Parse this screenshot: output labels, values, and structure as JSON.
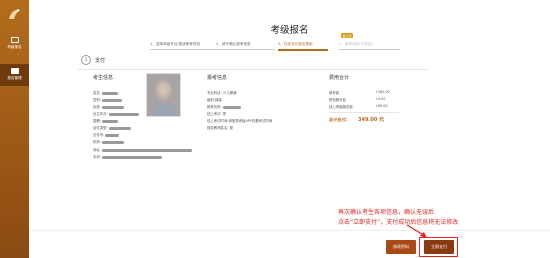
{
  "sidebar": {
    "items": [
      {
        "label": "考级报名",
        "icon": "id-card-icon"
      },
      {
        "label": "报名管理",
        "icon": "list-icon"
      }
    ]
  },
  "page": {
    "title": "考级报名"
  },
  "steps": [
    {
      "label": "1、选择考级专业/报读职考项目"
    },
    {
      "label": "2、填写确认报考信息"
    },
    {
      "label": "3、在线支付报名费用"
    },
    {
      "label": "4、报考成功(已报名)"
    }
  ],
  "step_badge": "第三步",
  "pay_section": {
    "number": "1",
    "label": "支付"
  },
  "personal": {
    "heading": "考生信息",
    "fields": [
      {
        "label": "姓名:"
      },
      {
        "label": "性别:"
      },
      {
        "label": "民族:"
      },
      {
        "label": "出生年月:"
      },
      {
        "label": "国籍:"
      },
      {
        "label": "证件类型:"
      },
      {
        "label": "证件号:"
      },
      {
        "label": "机构:"
      },
      {
        "label": "地址:"
      },
      {
        "label": "手机:"
      }
    ]
  },
  "exam": {
    "heading": "报考信息",
    "fields": [
      {
        "label": "专业科目:",
        "value": "少儿朗诵"
      },
      {
        "label": "级别:",
        "value": "肆级"
      },
      {
        "label": "报考名称:",
        "value": ""
      },
      {
        "label": "线上考试:",
        "value": "是"
      },
      {
        "label": "线上考试时间:",
        "value": "请登录考级APP查看考试时间"
      },
      {
        "label": "指导教师姓名:",
        "value": "是"
      }
    ]
  },
  "fees": {
    "heading": "费用合计",
    "items": [
      {
        "label": "报考费",
        "value": "+260.00"
      },
      {
        "label": "短信服务费",
        "value": "+4.00"
      },
      {
        "label": "线上考级服务费",
        "value": "+85.00"
      }
    ],
    "total_label": "总计支付:",
    "total_value": "349.00 元"
  },
  "annotation": {
    "line1": "再次确认考生各项信息，确认无误后",
    "line2": "点击“立即支付”，支付成功后信息将无法修改"
  },
  "buttons": {
    "back": "修改资料",
    "pay": "立即支付"
  },
  "colors": {
    "brand": "#b46d1c",
    "annotation": "#e0261f"
  }
}
